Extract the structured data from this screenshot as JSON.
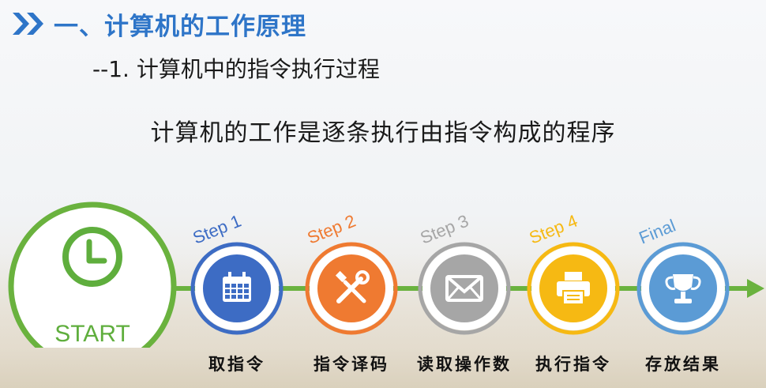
{
  "header": {
    "title": "一、计算机的工作原理",
    "subtitle": "--1. 计算机中的指令执行过程"
  },
  "statement": "计算机的工作是逐条执行由指令构成的程序",
  "flow": {
    "start_label": "START",
    "start_icon": "clock-icon",
    "steps": [
      {
        "tag": "Step 1",
        "caption": "取指令",
        "color": "#3d6cc4",
        "icon": "calendar-icon"
      },
      {
        "tag": "Step 2",
        "caption": "指令译码",
        "color": "#ef7a31",
        "icon": "tools-icon"
      },
      {
        "tag": "Step 3",
        "caption": "读取操作数",
        "color": "#a6a6a6",
        "icon": "envelope-icon"
      },
      {
        "tag": "Step 4",
        "caption": "执行指令",
        "color": "#f6b913",
        "icon": "printer-icon"
      },
      {
        "tag": "Final",
        "caption": "存放结果",
        "color": "#5b9bd5",
        "icon": "trophy-icon"
      }
    ],
    "line_color": "#6ab23e"
  }
}
